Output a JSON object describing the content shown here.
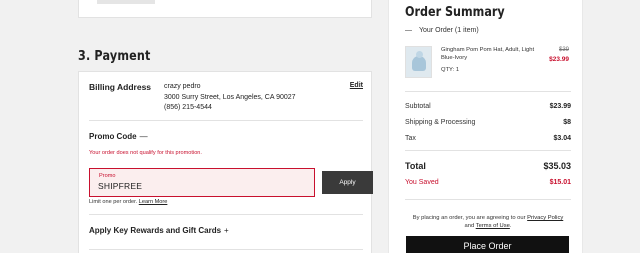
{
  "payment": {
    "section_title": "3. Payment",
    "billing": {
      "label": "Billing Address",
      "name": "crazy pedro",
      "street": "3000 Surry Street, Los Angeles, CA 90027",
      "phone": "(856) 215-4544",
      "edit_label": "Edit"
    },
    "promo": {
      "title": "Promo Code",
      "toggle": "—",
      "error": "Your order does not qualify for this promotion.",
      "field_label": "Promo",
      "field_value": "SHIPFREE",
      "apply_label": "Apply",
      "limit_text": "Limit one per order.",
      "learn_more": "Learn More"
    },
    "rewards": {
      "title": "Apply Key Rewards and Gift Cards",
      "toggle": "+"
    }
  },
  "summary": {
    "title": "Order Summary",
    "your_order": "Your Order (1 item)",
    "your_order_toggle": "—",
    "item": {
      "name": "Gingham Pom Pom Hat, Adult, Light Blue-Ivory",
      "qty": "QTY: 1",
      "original_price": "$39",
      "sale_price": "$23.99",
      "image_icon": "pom-pom-hat-thumbnail"
    },
    "subtotal_label": "Subtotal",
    "subtotal_value": "$23.99",
    "shipping_label": "Shipping & Processing",
    "shipping_value": "$8",
    "tax_label": "Tax",
    "tax_value": "$3.04",
    "total_label": "Total",
    "total_value": "$35.03",
    "saved_label": "You Saved",
    "saved_value": "$15.01",
    "agree_prefix": "By placing an order, you are agreeing to our",
    "privacy_link": "Privacy Policy",
    "agree_and": "and",
    "terms_link": "Terms of Use",
    "agree_suffix": ".",
    "place_order_label": "Place Order"
  },
  "colors": {
    "accent_red": "#c8102e",
    "button_dark": "#3a3a3a",
    "place_order_bg": "#111111",
    "page_bg": "#f1f1f1"
  }
}
